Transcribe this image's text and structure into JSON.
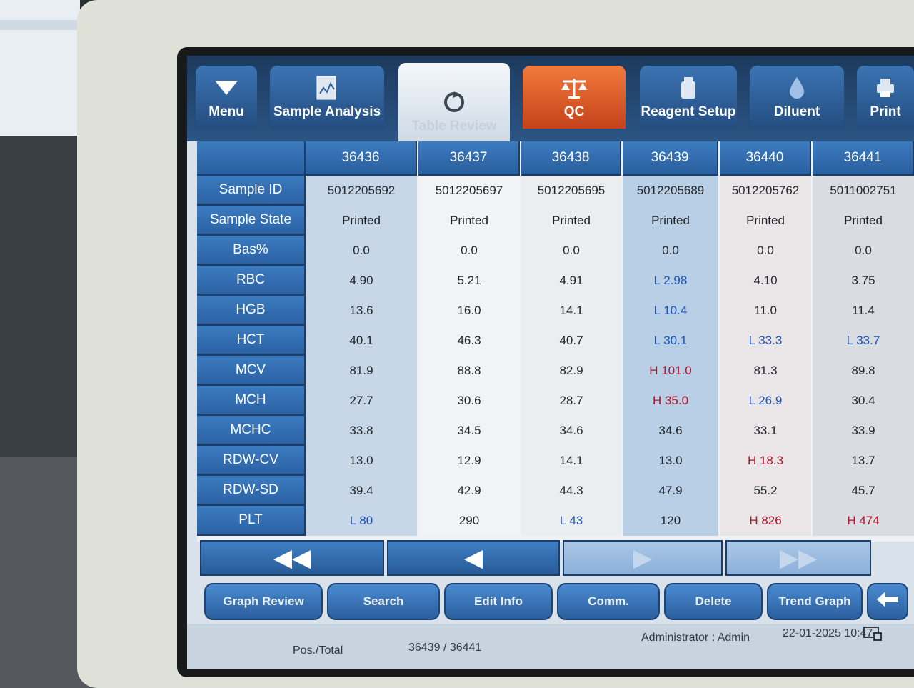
{
  "tabs": [
    {
      "label": "Menu",
      "icon": "triangle-down-icon"
    },
    {
      "label": "Sample Analysis",
      "icon": "chart-document-icon"
    },
    {
      "label": "Table Review",
      "icon": "refresh-icon"
    },
    {
      "label": "QC",
      "icon": "balance-scale-icon"
    },
    {
      "label": "Reagent Setup",
      "icon": "reagent-bottle-icon"
    },
    {
      "label": "Diluent",
      "icon": "droplet-icon"
    },
    {
      "label": "Print",
      "icon": "printer-icon"
    }
  ],
  "table": {
    "sample_numbers": [
      "36436",
      "36437",
      "36438",
      "36439",
      "36440",
      "36441"
    ],
    "rows": [
      {
        "label": "Sample ID",
        "values": [
          "5012205692",
          "5012205697",
          "5012205695",
          "5012205689",
          "5012205762",
          "5011002751"
        ]
      },
      {
        "label": "Sample State",
        "values": [
          "Printed",
          "Printed",
          "Printed",
          "Printed",
          "Printed",
          "Printed"
        ]
      },
      {
        "label": "Bas%",
        "values": [
          "0.0",
          "0.0",
          "0.0",
          "0.0",
          "0.0",
          "0.0"
        ]
      },
      {
        "label": "RBC",
        "values": [
          "4.90",
          "5.21",
          "4.91",
          "L 2.98",
          "4.10",
          "3.75"
        ]
      },
      {
        "label": "HGB",
        "values": [
          "13.6",
          "16.0",
          "14.1",
          "L 10.4",
          "11.0",
          "11.4"
        ]
      },
      {
        "label": "HCT",
        "values": [
          "40.1",
          "46.3",
          "40.7",
          "L 30.1",
          "L 33.3",
          "L 33.7"
        ]
      },
      {
        "label": "MCV",
        "values": [
          "81.9",
          "88.8",
          "82.9",
          "H 101.0",
          "81.3",
          "89.8"
        ]
      },
      {
        "label": "MCH",
        "values": [
          "27.7",
          "30.6",
          "28.7",
          "H 35.0",
          "L 26.9",
          "30.4"
        ]
      },
      {
        "label": "MCHC",
        "values": [
          "33.8",
          "34.5",
          "34.6",
          "34.6",
          "33.1",
          "33.9"
        ]
      },
      {
        "label": "RDW-CV",
        "values": [
          "13.0",
          "12.9",
          "14.1",
          "13.0",
          "H 18.3",
          "13.7"
        ]
      },
      {
        "label": "RDW-SD",
        "values": [
          "39.4",
          "42.9",
          "44.3",
          "47.9",
          "55.2",
          "45.7"
        ]
      },
      {
        "label": "PLT",
        "values": [
          "L 80",
          "290",
          "L 43",
          "120",
          "H 826",
          "H 474"
        ]
      }
    ]
  },
  "nav": {
    "first": "◀◀",
    "prev": "◀",
    "next": "▶",
    "last": "▶▶"
  },
  "buttons": {
    "graph_review": "Graph Review",
    "search": "Search",
    "edit_info": "Edit Info",
    "comm": "Comm.",
    "delete": "Delete",
    "trend_graph": "Trend Graph",
    "back_icon": "back-arrow-icon"
  },
  "status": {
    "pos_label": "Pos./Total",
    "pos_value": "36439 / 36441",
    "user": "Administrator : Admin",
    "datetime": "22-01-2025 10:47"
  },
  "colors": {
    "tab_blue": "#2b5f9e",
    "qc_orange": "#d9562a",
    "low_flag": "#1d54b8",
    "high_flag": "#b0152c"
  }
}
